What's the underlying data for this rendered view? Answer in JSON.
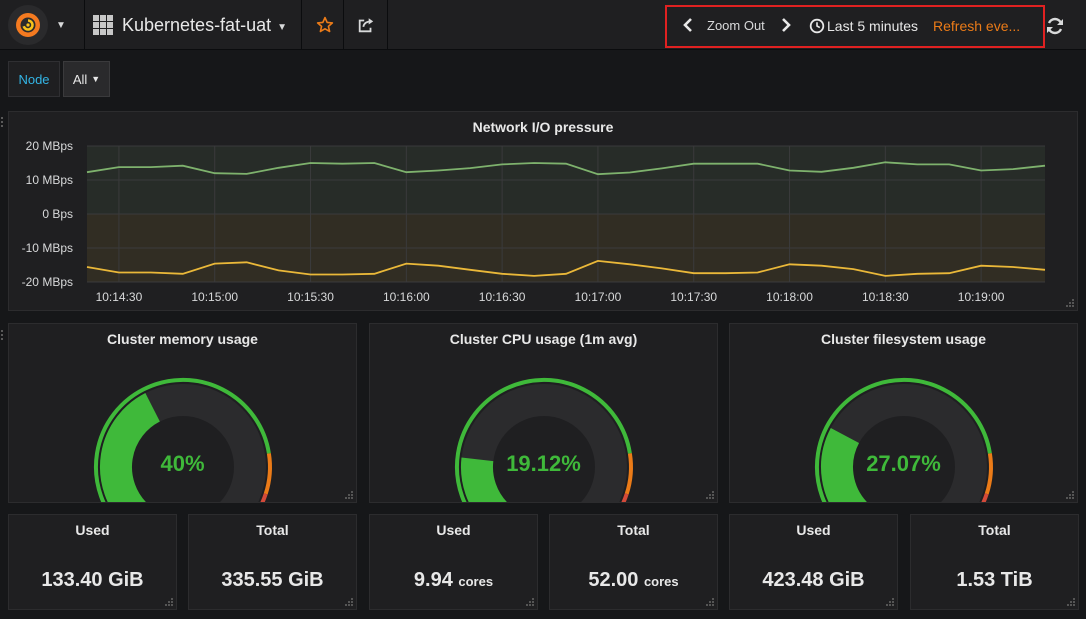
{
  "navbar": {
    "dashboard_title": "Kubernetes-fat-uat",
    "zoom_label": "Zoom Out",
    "time_range": "Last 5 minutes",
    "refresh_label": "Refresh eve..."
  },
  "variables": {
    "label": "Node",
    "value": "All"
  },
  "graph_panel": {
    "title": "Network I/O pressure"
  },
  "chart_data": {
    "type": "line",
    "title": "Network I/O pressure",
    "ylim": [
      -20,
      20
    ],
    "y_ticks": [
      "20 MBps",
      "10 MBps",
      "0 Bps",
      "-10 MBps",
      "-20 MBps"
    ],
    "y_tick_values": [
      20,
      10,
      0,
      -10,
      -20
    ],
    "x_ticks": [
      "10:14:30",
      "10:15:00",
      "10:15:30",
      "10:16:00",
      "10:16:30",
      "10:17:00",
      "10:17:30",
      "10:18:00",
      "10:18:30",
      "10:19:00"
    ],
    "x_tick_seconds": [
      30,
      60,
      90,
      120,
      150,
      180,
      210,
      240,
      270,
      300
    ],
    "x_seconds": [
      30,
      40,
      50,
      60,
      70,
      80,
      90,
      100,
      110,
      120,
      130,
      140,
      150,
      160,
      170,
      180,
      190,
      200,
      210,
      220,
      230,
      240,
      250,
      260,
      270,
      280,
      290,
      300,
      310,
      320
    ],
    "series": [
      {
        "color": "#7eb26d",
        "values": [
          12.3,
          13.8,
          13.8,
          14.2,
          12.0,
          11.8,
          13.6,
          15.0,
          14.8,
          15.0,
          12.3,
          12.8,
          13.5,
          14.6,
          15.0,
          14.8,
          11.7,
          12.2,
          13.4,
          14.8,
          14.8,
          14.8,
          12.8,
          12.4,
          13.6,
          15.2,
          14.6,
          14.6,
          12.8,
          13.2,
          14.2
        ]
      },
      {
        "color": "#eab839",
        "values": [
          -15.6,
          -17.2,
          -17.2,
          -17.6,
          -14.6,
          -14.2,
          -16.6,
          -17.8,
          -17.8,
          -17.6,
          -14.6,
          -15.2,
          -16.4,
          -17.6,
          -18.2,
          -17.6,
          -13.8,
          -14.8,
          -16.0,
          -17.4,
          -17.4,
          -17.2,
          -14.8,
          -15.2,
          -16.2,
          -18.2,
          -17.6,
          -17.4,
          -15.2,
          -15.6,
          -16.4
        ]
      }
    ]
  },
  "gauges": [
    {
      "title": "Cluster memory usage",
      "value_text": "40%",
      "value": 0.4
    },
    {
      "title": "Cluster CPU usage (1m avg)",
      "value_text": "19.12%",
      "value": 0.1912
    },
    {
      "title": "Cluster filesystem usage",
      "value_text": "27.07%",
      "value": 0.2707
    }
  ],
  "gauge_thresholds": {
    "green_end": 0.8,
    "orange_end": 0.9
  },
  "colors": {
    "green": "#3fb93a",
    "orange": "#eb7b18",
    "red": "#d44a3a",
    "refresh": "#eb7b18",
    "variable": "#33b5e5",
    "highlight": "#e02121"
  },
  "stats": [
    {
      "title": "Used",
      "value": "133.40 GiB",
      "unit": ""
    },
    {
      "title": "Total",
      "value": "335.55 GiB",
      "unit": ""
    },
    {
      "title": "Used",
      "value": "9.94",
      "unit": "cores"
    },
    {
      "title": "Total",
      "value": "52.00",
      "unit": "cores"
    },
    {
      "title": "Used",
      "value": "423.48 GiB",
      "unit": ""
    },
    {
      "title": "Total",
      "value": "1.53 TiB",
      "unit": ""
    }
  ],
  "icons": [
    "grafana-logo-icon",
    "dashboard-grid-icon",
    "star-icon",
    "share-icon",
    "chevron-left-icon",
    "chevron-right-icon",
    "clock-icon",
    "refresh-icon"
  ]
}
